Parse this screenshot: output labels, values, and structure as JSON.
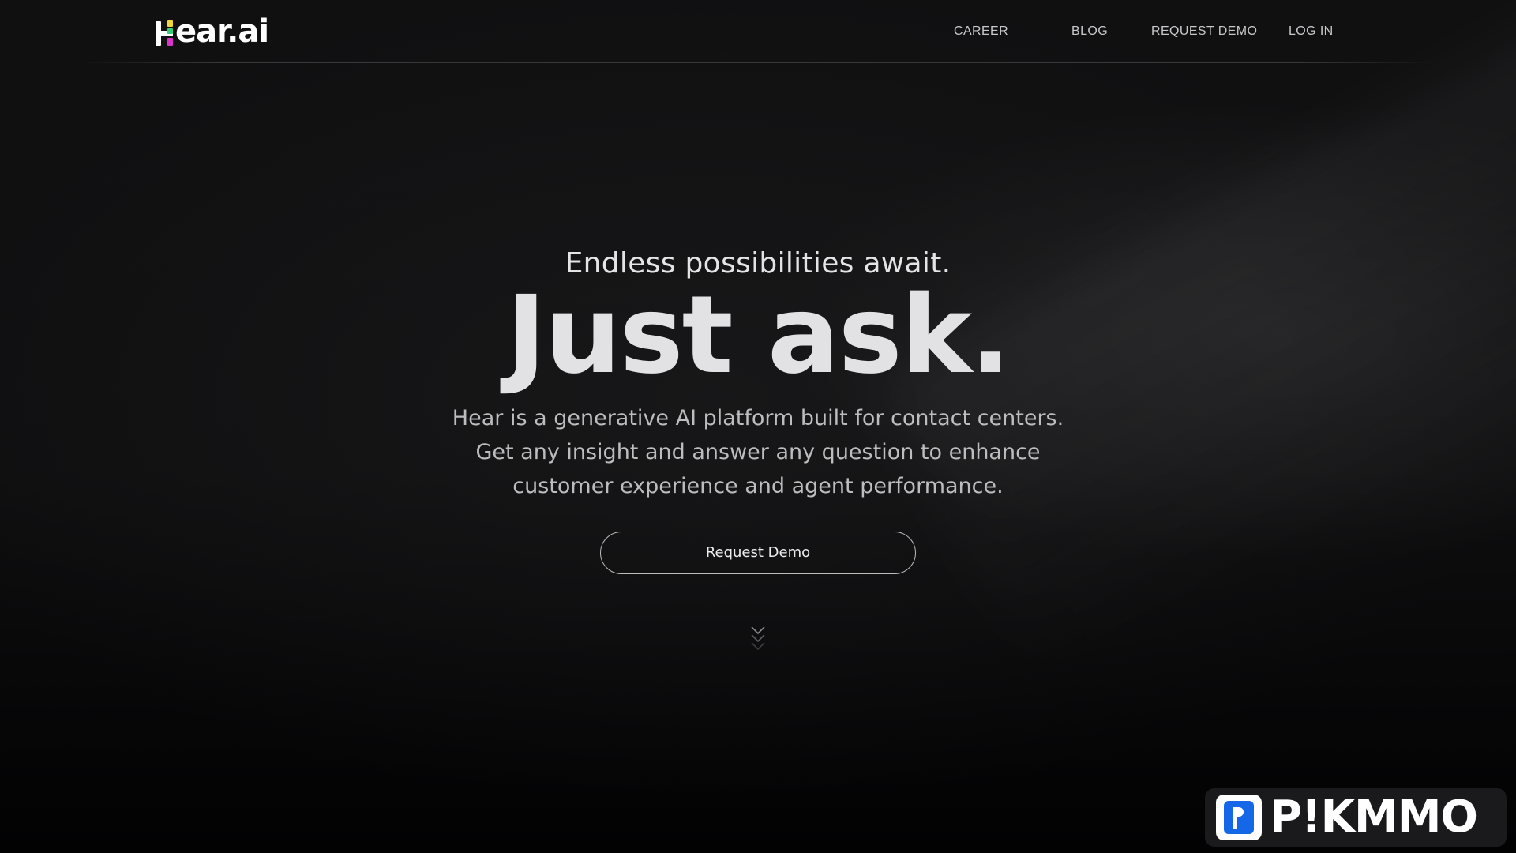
{
  "header": {
    "logo": {
      "text": "ear.ai",
      "icon": "hear-logo-icon",
      "colors": {
        "yellow": "#f2d43b",
        "green": "#35d07a",
        "magenta": "#d935c9"
      }
    },
    "nav": [
      {
        "label": "CAREER"
      },
      {
        "label": "BLOG"
      },
      {
        "label": "REQUEST DEMO"
      },
      {
        "label": "LOG IN"
      }
    ]
  },
  "hero": {
    "eyebrow": "Endless possibilities await.",
    "headline": "Just ask.",
    "description": "Hear is a generative AI platform built for contact centers. Get any insight and answer any question to enhance customer experience and agent performance.",
    "cta_label": "Request Demo",
    "scroll_icon": "chevron-down-triple-icon"
  },
  "watermark": {
    "text": "P!KMMO",
    "icon": "pikmmo-p-icon",
    "accent": "#1467e6"
  },
  "theme": {
    "background": "#0d0d0e",
    "text_primary": "#e2e2e4",
    "text_secondary": "#bdbdc0"
  }
}
